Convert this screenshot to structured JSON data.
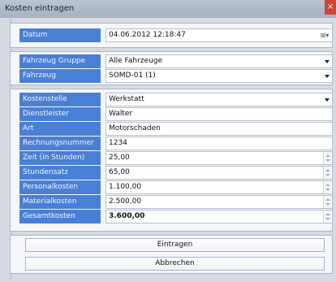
{
  "window": {
    "title": "Kosten eintragen",
    "close_symbol": "×"
  },
  "datum": {
    "label": "Datum",
    "value": "04.06.2012 12:18:47",
    "button": "⊞▾"
  },
  "fahrzeug_gruppe": {
    "label": "Fahrzeug Gruppe",
    "value": "Alle Fahrzeuge"
  },
  "fahrzeug": {
    "label": "Fahrzeug",
    "value": "SOMD-01 (1)"
  },
  "kostenstelle": {
    "label": "Kostenstelle",
    "value": "Werkstatt"
  },
  "dienstleister": {
    "label": "Dienstleister",
    "value": "Walter"
  },
  "art": {
    "label": "Art",
    "value": "Motorschaden"
  },
  "rechnungsnummer": {
    "label": "Rechnungsnummer",
    "value": "1234"
  },
  "zeit_stunden": {
    "label": "Zeit (in Stunden)",
    "value": "25,00"
  },
  "stundensatz": {
    "label": "Stundensatz",
    "value": "65,00"
  },
  "personalkosten": {
    "label": "Personalkosten",
    "value": "1.100,00"
  },
  "materialkosten": {
    "label": "Materialkosten",
    "value": "2.500,00"
  },
  "gesamtkosten": {
    "label": "Gesamtkosten",
    "value": "3.600,00"
  },
  "buttons": {
    "submit": "Eintragen",
    "cancel": "Abbrechen"
  }
}
